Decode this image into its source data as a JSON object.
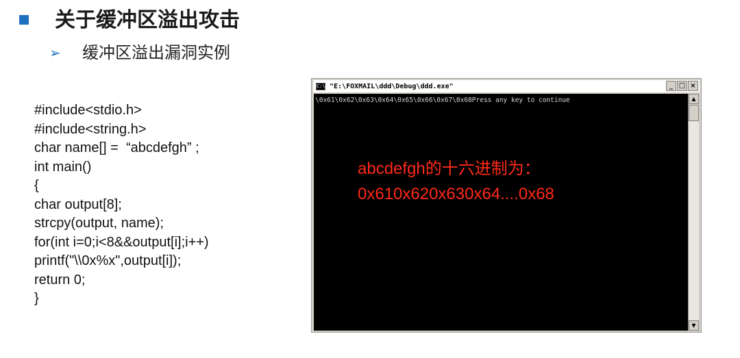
{
  "slide": {
    "title": "关于缓冲区溢出攻击",
    "subtitle": "缓冲区溢出漏洞实例",
    "accent_color": "#1f6fc1",
    "bullet_icon": "square-bullet-icon",
    "sub_bullet_icon": "arrow-bullet-icon"
  },
  "code": {
    "lines": [
      "#include<stdio.h>",
      "#include<string.h>",
      "char name[] =  “abcdefgh” ;",
      "int main()",
      "{",
      "char output[8];",
      "strcpy(output, name);",
      "for(int i=0;i<8&&output[i];i++)",
      "printf(\"\\\\0x%x\",output[i]);",
      "return 0;",
      "}"
    ]
  },
  "console_window": {
    "title": "\"E:\\FOXMAIL\\ddd\\Debug\\ddd.exe\"",
    "app_icon": "console-app-icon",
    "output_line": "\\0x61\\0x62\\0x63\\0x64\\0x65\\0x66\\0x67\\0x68Press any key to continue",
    "buttons": {
      "minimize": "_",
      "maximize": "□",
      "close": "×"
    }
  },
  "annotation": {
    "line1": "abcdefgh的十六进制为：",
    "line2": "0x610x620x630x64....0x68",
    "color": "#ff2a1a"
  }
}
